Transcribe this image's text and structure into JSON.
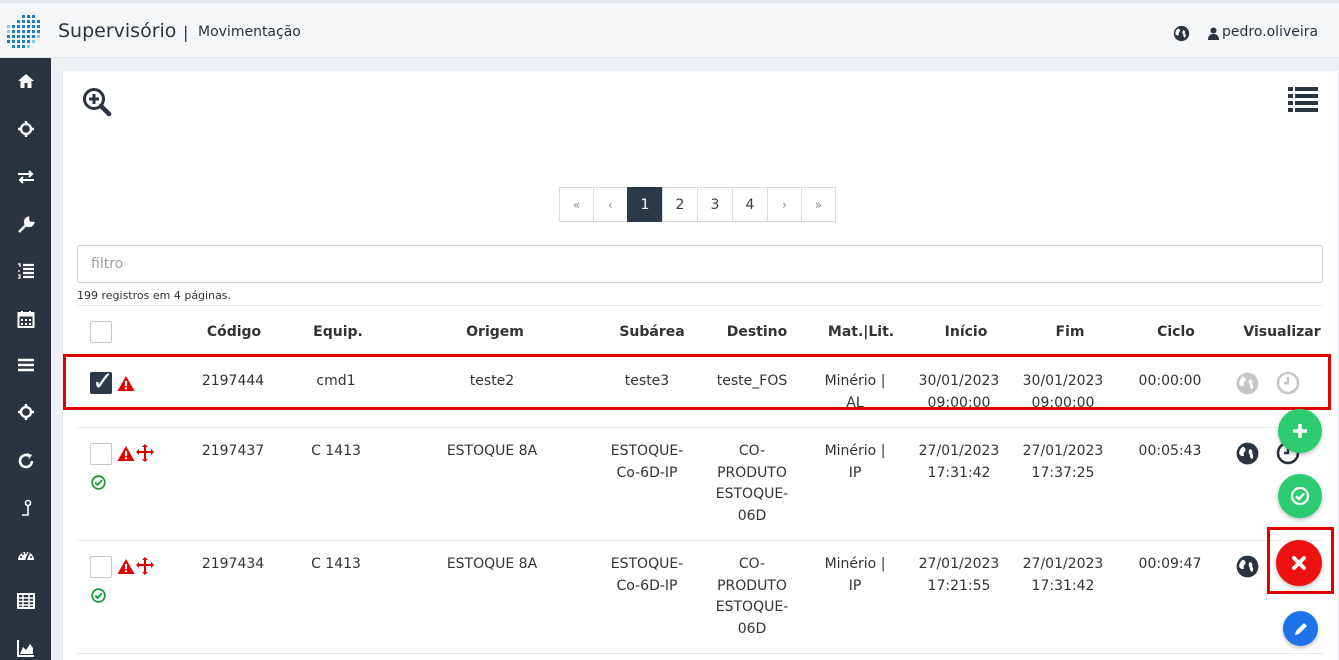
{
  "header": {
    "app_title": "Supervisório",
    "separator": "|",
    "page_title": "Movimentação",
    "user": "pedro.oliveira"
  },
  "sidebar": {
    "items": [
      "home-icon",
      "crosshair-icon",
      "transfer-icon",
      "wrench-icon",
      "numbered-list-icon",
      "calendar-icon",
      "menu-icon",
      "crosshair-icon",
      "refresh-icon",
      "pin-icon",
      "dashboard-icon",
      "table-icon",
      "area-chart-icon"
    ]
  },
  "pagination": {
    "first": "«",
    "prev": "‹",
    "pages": [
      "1",
      "2",
      "3",
      "4"
    ],
    "active": "1",
    "next": "›",
    "last": "»"
  },
  "filter": {
    "placeholder": "filtro"
  },
  "records_info": "199 registros em 4 páginas.",
  "table": {
    "headers": {
      "codigo": "Código",
      "equip": "Equip.",
      "origem": "Origem",
      "subarea": "Subárea",
      "destino": "Destino",
      "mat_lit": "Mat.|Lit.",
      "inicio": "Início",
      "fim": "Fim",
      "ciclo": "Ciclo",
      "visualizar": "Visualizar"
    },
    "rows": [
      {
        "checked": true,
        "codigo": "2197444",
        "equip": "cmd1",
        "origem": "teste2",
        "subarea": "teste3",
        "destino": "teste_FOS",
        "mat_lit": "Minério | AL",
        "inicio": "30/01/2023 09:00:00",
        "fim": "30/01/2023 09:00:00",
        "ciclo": "00:00:00"
      },
      {
        "checked": false,
        "codigo": "2197437",
        "equip": "C 1413",
        "origem": "ESTOQUE 8A",
        "subarea": "ESTOQUE-Co-6D-IP",
        "destino": "CO-PRODUTO ESTOQUE-06D",
        "mat_lit": "Minério | IP",
        "inicio": "27/01/2023 17:31:42",
        "fim": "27/01/2023 17:37:25",
        "ciclo": "00:05:43"
      },
      {
        "checked": false,
        "codigo": "2197434",
        "equip": "C 1413",
        "origem": "ESTOQUE 8A",
        "subarea": "ESTOQUE-Co-6D-IP",
        "destino": "CO-PRODUTO ESTOQUE-06D",
        "mat_lit": "Minério | IP",
        "inicio": "27/01/2023 17:21:55",
        "fim": "27/01/2023 17:31:42",
        "ciclo": "00:09:47"
      }
    ]
  },
  "colors": {
    "sidebar_bg": "#2b333e",
    "active_page": "#2b3846",
    "warning_red": "#e00000",
    "success_green": "#2ecc71",
    "danger_red": "#ee1111",
    "edit_blue": "#1e73e8"
  }
}
